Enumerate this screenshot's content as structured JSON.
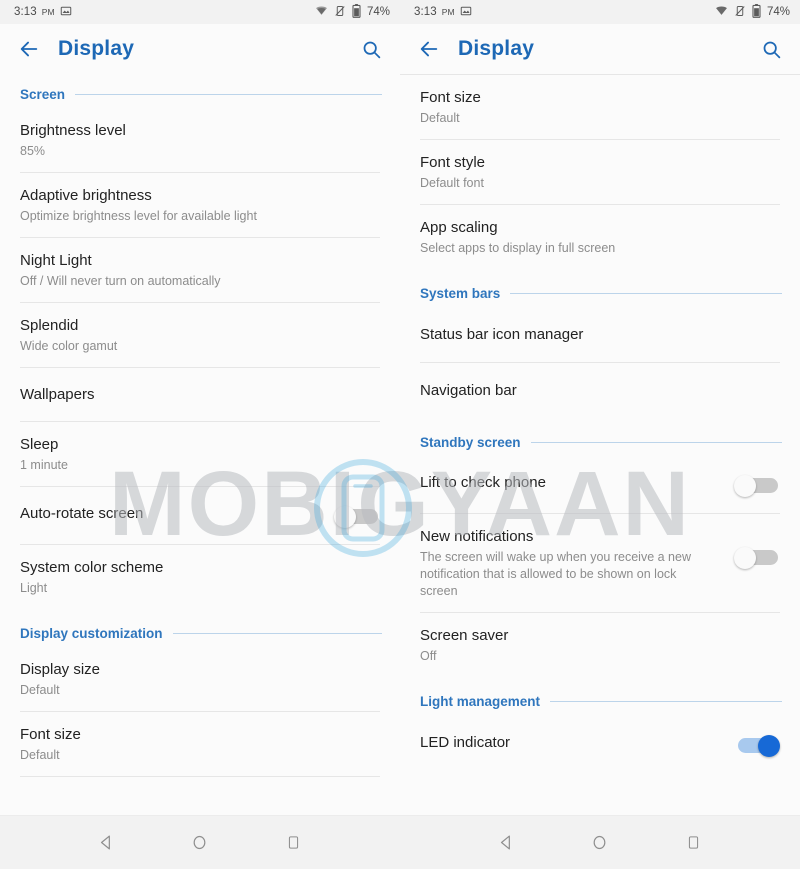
{
  "status_bar": {
    "time": "3:13",
    "ampm": "PM",
    "screenshot_icon": "image-icon",
    "wifi_icon": "wifi-icon",
    "vibrate_off_icon": "vibrate-off-icon",
    "battery_icon": "battery-icon",
    "battery_level": "74%"
  },
  "app_bar": {
    "back_icon": "back-arrow-icon",
    "title": "Display",
    "search_icon": "search-icon"
  },
  "colors": {
    "accent_blue": "#2f76bd",
    "title_blue": "#1d68b5",
    "toggle_on": "#1769d6",
    "toggle_on_track": "#a8c9ee",
    "toggle_off_track": "#c9c9c9",
    "background": "#fbfbfb",
    "divider": "#e6e6e6",
    "primary_text": "#222222",
    "secondary_text": "#8c8c8c"
  },
  "watermark": {
    "text": "MOBIGYAAN"
  },
  "nav_bar": {
    "back_icon": "nav-back-triangle-icon",
    "home_icon": "nav-home-circle-icon",
    "recents_icon": "nav-recents-square-icon"
  },
  "left_panel": {
    "sections": [
      {
        "header": "Screen",
        "rows": [
          {
            "title": "Brightness level",
            "subtitle": "85%",
            "toggle": null
          },
          {
            "title": "Adaptive brightness",
            "subtitle": "Optimize brightness level for available light",
            "toggle": null
          },
          {
            "title": "Night Light",
            "subtitle": "Off / Will never turn on automatically",
            "toggle": null
          },
          {
            "title": "Splendid",
            "subtitle": "Wide color gamut",
            "toggle": null
          },
          {
            "title": "Wallpapers",
            "subtitle": "",
            "toggle": null
          },
          {
            "title": "Sleep",
            "subtitle": "1 minute",
            "toggle": null
          },
          {
            "title": "Auto-rotate screen",
            "subtitle": "",
            "toggle": "off"
          },
          {
            "title": "System color scheme",
            "subtitle": "Light",
            "toggle": null
          }
        ]
      },
      {
        "header": "Display customization",
        "rows": [
          {
            "title": "Display size",
            "subtitle": "Default",
            "toggle": null
          },
          {
            "title": "Font size",
            "subtitle": "Default",
            "toggle": null
          }
        ]
      }
    ]
  },
  "right_panel": {
    "sections": [
      {
        "header": "",
        "rows": [
          {
            "title": "Font size",
            "subtitle": "Default",
            "toggle": null
          },
          {
            "title": "Font style",
            "subtitle": "Default font",
            "toggle": null
          },
          {
            "title": "App scaling",
            "subtitle": "Select apps to display in full screen",
            "toggle": null
          }
        ]
      },
      {
        "header": "System bars",
        "rows": [
          {
            "title": "Status bar icon manager",
            "subtitle": "",
            "toggle": null
          },
          {
            "title": "Navigation bar",
            "subtitle": "",
            "toggle": null
          }
        ]
      },
      {
        "header": "Standby screen",
        "rows": [
          {
            "title": "Lift to check phone",
            "subtitle": "",
            "toggle": "off"
          },
          {
            "title": "New notifications",
            "subtitle": "The screen will wake up when you receive a new notification that is allowed to be shown on lock screen",
            "toggle": "off"
          },
          {
            "title": "Screen saver",
            "subtitle": "Off",
            "toggle": null
          }
        ]
      },
      {
        "header": "Light management",
        "rows": [
          {
            "title": "LED indicator",
            "subtitle": "",
            "toggle": "on"
          }
        ]
      }
    ]
  }
}
